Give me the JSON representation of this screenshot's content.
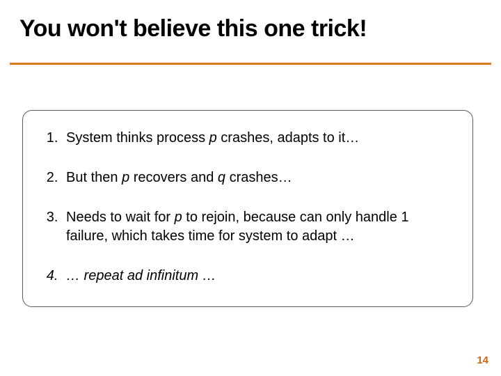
{
  "slide": {
    "title": "You won't believe this one trick!",
    "steps": [
      {
        "pre": "System thinks process ",
        "em1": "p",
        "mid": " crashes, adapts to it…",
        "em2": "",
        "post": ""
      },
      {
        "pre": "But then ",
        "em1": "p",
        "mid": " recovers and ",
        "em2": "q",
        "post": " crashes…"
      },
      {
        "pre": "Needs to wait for ",
        "em1": "p",
        "mid": " to rejoin, because can only handle 1 failure, which takes time for system to adapt …",
        "em2": "",
        "post": ""
      }
    ],
    "final_step": "… repeat ad infinitum …",
    "page_number": "14",
    "accent_color": "#d97a1a"
  }
}
